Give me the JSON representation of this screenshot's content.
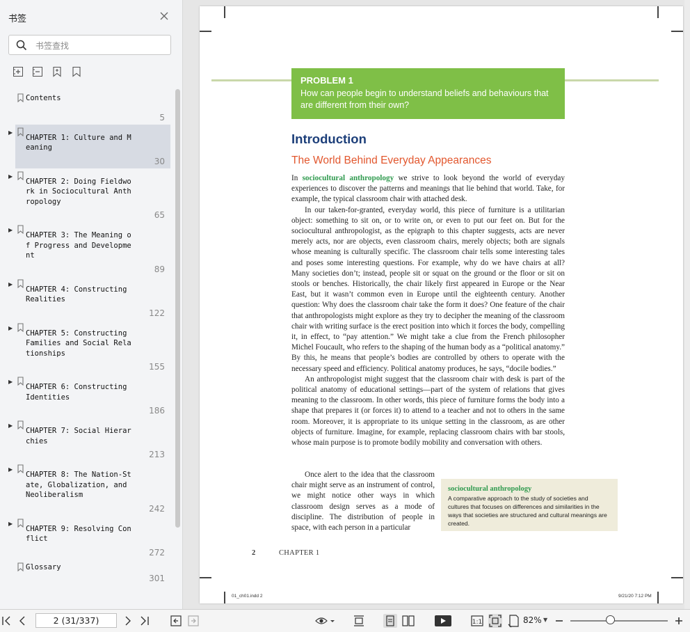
{
  "sidebar": {
    "title": "书签",
    "search_placeholder": "书签查找",
    "bookmarks": [
      {
        "label": "Contents",
        "page": "5",
        "expandable": false,
        "selected": false
      },
      {
        "label": "CHAPTER 1: Culture and M\neaning",
        "page": "30",
        "expandable": true,
        "selected": true
      },
      {
        "label": "CHAPTER 2: Doing Fieldwo\nrk in Sociocultural Anth\nropology",
        "page": "65",
        "expandable": true,
        "selected": false
      },
      {
        "label": "CHAPTER 3: The Meaning o\nf Progress and Developme\nnt",
        "page": "89",
        "expandable": true,
        "selected": false
      },
      {
        "label": "CHAPTER 4: Constructing\nRealities",
        "page": "122",
        "expandable": true,
        "selected": false
      },
      {
        "label": "CHAPTER 5: Constructing\nFamilies and Social Rela\ntionships",
        "page": "155",
        "expandable": true,
        "selected": false
      },
      {
        "label": "CHAPTER 6: Constructing\nIdentities",
        "page": "186",
        "expandable": true,
        "selected": false
      },
      {
        "label": "CHAPTER 7: Social Hierar\nchies",
        "page": "213",
        "expandable": true,
        "selected": false
      },
      {
        "label": "CHAPTER 8: The Nation-St\nate, Globalization, and\nNeoliberalism",
        "page": "242",
        "expandable": true,
        "selected": false
      },
      {
        "label": "CHAPTER 9: Resolving Con\nflict",
        "page": "272",
        "expandable": true,
        "selected": false
      },
      {
        "label": "Glossary",
        "page": "301",
        "expandable": false,
        "selected": false
      }
    ]
  },
  "document": {
    "problem_title": "PROBLEM 1",
    "problem_text": "How can people begin to understand beliefs and behaviours that are different from their own?",
    "heading": "Introduction",
    "subheading": "The World Behind Everyday Appearances",
    "p1_lead": "In ",
    "p1_term": "sociocultural anthropology",
    "p1_rest": " we strive to look beyond the world of everyday experiences to discover the patterns and meanings that lie behind that world. Take, for example, the typical classroom chair with attached desk.",
    "p2": "In our taken-for-granted, everyday world, this piece of furniture is a utilitarian object: something to sit on, or to write on, or even to put our feet on. But for the sociocultural anthropologist, as the epigraph to this chapter suggests, acts are never merely acts, nor are objects, even classroom chairs, merely objects; both are signals whose meaning is culturally specific. The classroom chair tells some interesting tales and poses some interesting questions. For example, why do we have chairs at all? Many societies don’t; instead, people sit or squat on the ground or the floor or sit on stools or benches. Historically, the chair likely first appeared in Europe or the Near East, but it wasn’t common even in Europe until the eighteenth century. Another question: Why does the classroom chair take the form it does? One feature of the chair that anthropologists might explore as they try to decipher the meaning of the classroom chair with writing surface is the erect position into which it forces the body, compelling it, in effect, to “pay attention.” We might take a clue from the French philosopher Michel Foucault, who refers to the shaping of the human body as a “political anatomy.” By this, he means that people’s bodies are controlled by others to operate with the necessary speed and efficiency. Political anatomy produces, he says, “docile bodies.”",
    "p3": "An anthropologist might suggest that the classroom chair with desk is part of the political anatomy of educational settings—part of the system of relations that gives meaning to the classroom. In other words, this piece of furniture forms the body into a shape that prepares it (or forces it) to attend to a teacher and not to others in the same room. Moreover, it is appropriate to its unique setting in the classroom, as are other objects of furniture. Imagine, for example, replacing classroom chairs with bar stools, whose main purpose is to promote bodily mobility and conversation with others.",
    "p4": "Once alert to the idea that the classroom chair might serve as an instrument of control, we might notice other ways in which classroom design serves as a mode of discipline. The distribution of people in space, with each person in a particular",
    "definition_term": "sociocultural anthropology",
    "definition_text": "A comparative approach to the study of societies and cultures that focuses on differences and similarities in the ways that societies are structured and cultural meanings are created.",
    "page_number": "2",
    "footer_chapter": "CHAPTER 1",
    "slug_left": "01_ch01.indd   2",
    "slug_right": "9/21/20   7:12 PM",
    "accent_green": "#7fbf47",
    "heading_blue": "#1d3f7a",
    "subheading_orange": "#e2572e"
  },
  "statusbar": {
    "page_indicator": "2 (31/337)",
    "zoom": "82%"
  }
}
